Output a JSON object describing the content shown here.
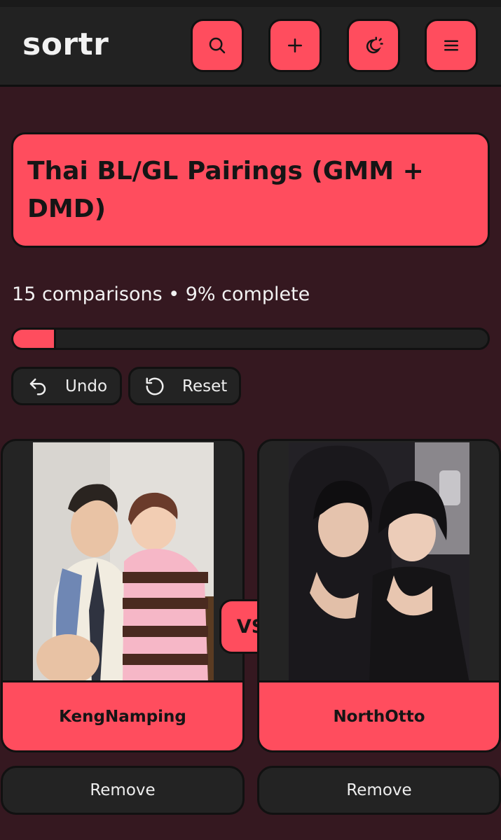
{
  "app": {
    "logo": "sortr"
  },
  "header": {
    "buttons": [
      {
        "icon": "search-icon"
      },
      {
        "icon": "plus-icon"
      },
      {
        "icon": "theme-toggle-icon"
      },
      {
        "icon": "menu-icon"
      }
    ]
  },
  "sorter": {
    "title": "Thai BL/GL Pairings (GMM + DMD)",
    "stats": "15 comparisons • 9% complete",
    "progress_percent": 9
  },
  "actions": {
    "undo_label": "Undo",
    "reset_label": "Reset"
  },
  "comparison": {
    "vs_label": "VS",
    "left": {
      "name": "KengNamping",
      "remove_label": "Remove"
    },
    "right": {
      "name": "NorthOtto",
      "remove_label": "Remove"
    }
  },
  "colors": {
    "accent": "#ff4d5e",
    "background": "#351820",
    "surface": "#232323",
    "outline": "#111111"
  }
}
